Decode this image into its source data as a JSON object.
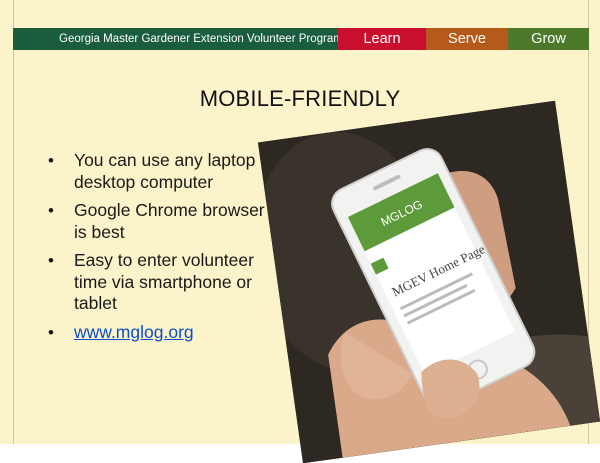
{
  "banner": {
    "program": "Georgia Master Gardener Extension Volunteer Program",
    "tabs": [
      "Learn",
      "Serve",
      "Grow"
    ]
  },
  "title": "MOBILE-FRIENDLY",
  "bullets": [
    "You can use any laptop or desktop computer",
    "Google Chrome browser is best",
    "Easy to enter volunteer time via smartphone or tablet",
    "www.mglog.org"
  ],
  "photo": {
    "screen_lines": [
      "MGLOG",
      "MGEV Home Page"
    ]
  },
  "colors": {
    "background": "#fbf3c9",
    "banner_green": "#1a5c3e",
    "learn": "#c8102e",
    "serve": "#b65a1c",
    "grow": "#4c7a2a",
    "link": "#0b4fc8"
  }
}
